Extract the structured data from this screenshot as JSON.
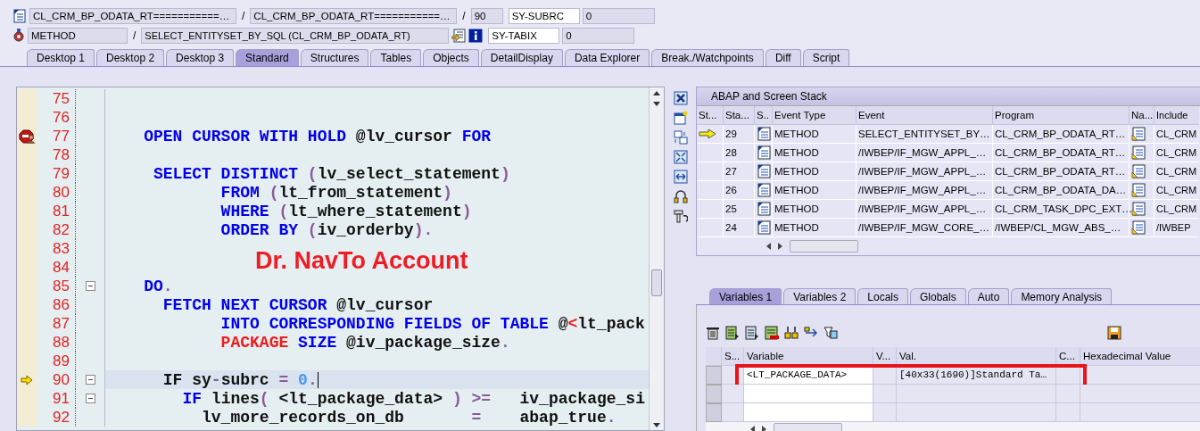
{
  "header": {
    "rows": [
      {
        "fields": [
          {
            "value": "CL_CRM_BP_ODATA_RT===========…"
          },
          {
            "sep": "/",
            "value": "CL_CRM_BP_ODATA_RT===========…"
          },
          {
            "sep": "/",
            "value": "90"
          }
        ],
        "sys": {
          "name": "SY-SUBRC",
          "value": "0"
        }
      },
      {
        "fields": [
          {
            "value": "METHOD"
          },
          {
            "sep": "/",
            "value": "SELECT_ENTITYSET_BY_SQL (CL_CRM_BP_ODATA_RT)"
          }
        ],
        "sys": {
          "name": "SY-TABIX",
          "value": "0"
        }
      }
    ]
  },
  "tabs": [
    {
      "label": "Desktop 1",
      "selected": false
    },
    {
      "label": "Desktop 2",
      "selected": false
    },
    {
      "label": "Desktop 3",
      "selected": false
    },
    {
      "label": "Standard",
      "selected": true
    },
    {
      "label": "Structures",
      "selected": false
    },
    {
      "label": "Tables",
      "selected": false
    },
    {
      "label": "Objects",
      "selected": false
    },
    {
      "label": "DetailDisplay",
      "selected": false
    },
    {
      "label": "Data Explorer",
      "selected": false
    },
    {
      "label": "Break./Watchpoints",
      "selected": false
    },
    {
      "label": "Diff",
      "selected": false
    },
    {
      "label": "Script",
      "selected": false
    }
  ],
  "editor": {
    "annotation": "Dr. NavTo Account",
    "lines": [
      {
        "number": "75",
        "fold": false,
        "highlighted": false
      },
      {
        "number": "76",
        "fold": false,
        "highlighted": false
      },
      {
        "number": "77",
        "fold": false,
        "highlighted": false,
        "breakpoint": true,
        "tokens": [
          {
            "t": "    OPEN CURSOR WITH HOLD ",
            "kind": "kw"
          },
          {
            "t": "@lv_cursor ",
            "kind": "id"
          },
          {
            "t": "FOR",
            "kind": "kw"
          }
        ]
      },
      {
        "number": "78",
        "fold": false,
        "highlighted": false
      },
      {
        "number": "79",
        "fold": false,
        "highlighted": false,
        "tokens": [
          {
            "t": "     SELECT DISTINCT ",
            "kind": "kw"
          },
          {
            "t": "(",
            "kind": "op"
          },
          {
            "t": "lv_select_statement",
            "kind": "id"
          },
          {
            "t": ")",
            "kind": "op"
          }
        ]
      },
      {
        "number": "80",
        "fold": false,
        "highlighted": false,
        "tokens": [
          {
            "t": "            FROM ",
            "kind": "kw"
          },
          {
            "t": "(",
            "kind": "op"
          },
          {
            "t": "lt_from_statement",
            "kind": "id"
          },
          {
            "t": ")",
            "kind": "op"
          }
        ]
      },
      {
        "number": "81",
        "fold": false,
        "highlighted": false,
        "tokens": [
          {
            "t": "            WHERE ",
            "kind": "kw"
          },
          {
            "t": "(",
            "kind": "op"
          },
          {
            "t": "lt_where_statement",
            "kind": "id"
          },
          {
            "t": ")",
            "kind": "op"
          }
        ]
      },
      {
        "number": "82",
        "fold": false,
        "highlighted": false,
        "tokens": [
          {
            "t": "            ORDER BY ",
            "kind": "kw"
          },
          {
            "t": "(",
            "kind": "op"
          },
          {
            "t": "iv_orderby",
            "kind": "id"
          },
          {
            "t": ").",
            "kind": "op"
          }
        ]
      },
      {
        "number": "83",
        "fold": false,
        "highlighted": false
      },
      {
        "number": "84",
        "fold": false,
        "highlighted": false
      },
      {
        "number": "85",
        "fold": true,
        "highlighted": false,
        "tokens": [
          {
            "t": "    DO",
            "kind": "kw"
          },
          {
            "t": ".",
            "kind": "op"
          }
        ]
      },
      {
        "number": "86",
        "fold": false,
        "highlighted": false,
        "tokens": [
          {
            "t": "      FETCH NEXT CURSOR ",
            "kind": "kw"
          },
          {
            "t": "@lv_cursor",
            "kind": "id"
          }
        ]
      },
      {
        "number": "87",
        "fold": false,
        "highlighted": false,
        "tokens": [
          {
            "t": "            INTO CORRESPONDING FIELDS OF TABLE ",
            "kind": "kw"
          },
          {
            "t": "@",
            "kind": "id"
          },
          {
            "t": "<",
            "kind": "lit"
          },
          {
            "t": "lt_pack",
            "kind": "id"
          }
        ]
      },
      {
        "number": "88",
        "fold": false,
        "highlighted": false,
        "tokens": [
          {
            "t": "            PACKAGE ",
            "kind": "lit"
          },
          {
            "t": "SIZE ",
            "kind": "kw"
          },
          {
            "t": "@iv_package_size",
            "kind": "id"
          },
          {
            "t": ".",
            "kind": "op"
          }
        ]
      },
      {
        "number": "89",
        "fold": false,
        "highlighted": false
      },
      {
        "number": "90",
        "fold": true,
        "highlighted": true,
        "execution_point": true,
        "tokens": [
          {
            "t": "      IF sy",
            "kind": "id"
          },
          {
            "t": "-",
            "kind": "op"
          },
          {
            "t": "subrc ",
            "kind": "id"
          },
          {
            "t": "= ",
            "kind": "op"
          },
          {
            "t": "0",
            "kind": "num"
          },
          {
            "t": ".",
            "kind": "op"
          }
        ]
      },
      {
        "number": "91",
        "fold": true,
        "highlighted": false,
        "tokens": [
          {
            "t": "        IF ",
            "kind": "kw"
          },
          {
            "t": "lines",
            "kind": "id"
          },
          {
            "t": "( ",
            "kind": "op"
          },
          {
            "t": "<lt_package_data> ",
            "kind": "id"
          },
          {
            "t": ") >=",
            "kind": "op"
          },
          {
            "t": "   iv_package_si",
            "kind": "id"
          }
        ]
      },
      {
        "number": "92",
        "fold": false,
        "highlighted": false,
        "tokens": [
          {
            "t": "          lv_more_records_on_db       ",
            "kind": "id"
          },
          {
            "t": "=",
            "kind": "op"
          },
          {
            "t": "    abap_true",
            "kind": "id"
          },
          {
            "t": ".",
            "kind": "op"
          }
        ]
      }
    ]
  },
  "stack": {
    "title": "ABAP and Screen Stack",
    "columns": [
      "St...",
      "Sta...",
      "S..",
      "Event Type",
      "Event",
      "Program",
      "Na...",
      "Include"
    ],
    "rows": [
      {
        "current": true,
        "level": "29",
        "event_type": "METHOD",
        "event": "SELECT_ENTITYSET_BY…",
        "program": "CL_CRM_BP_ODATA_RT…",
        "include": "CL_CRM"
      },
      {
        "current": false,
        "level": "28",
        "event_type": "METHOD",
        "event": "/IWBEP/IF_MGW_APPL_…",
        "program": "CL_CRM_BP_ODATA_RT…",
        "include": "CL_CRM"
      },
      {
        "current": false,
        "level": "27",
        "event_type": "METHOD",
        "event": "/IWBEP/IF_MGW_APPL_…",
        "program": "CL_CRM_BP_ODATA_RT…",
        "include": "CL_CRM"
      },
      {
        "current": false,
        "level": "26",
        "event_type": "METHOD",
        "event": "/IWBEP/IF_MGW_APPL_…",
        "program": "CL_CRM_BP_ODATA_DA…",
        "include": "CL_CRM"
      },
      {
        "current": false,
        "level": "25",
        "event_type": "METHOD",
        "event": "/IWBEP/IF_MGW_APPL_…",
        "program": "CL_CRM_TASK_DPC_EXT…",
        "include": "CL_CRM"
      },
      {
        "current": false,
        "level": "24",
        "event_type": "METHOD",
        "event": "/IWBEP/IF_MGW_CORE_…",
        "program": "/IWBEP/CL_MGW_ABS_…",
        "include": "/IWBEP"
      }
    ]
  },
  "variable_tabs": [
    {
      "label": "Variables 1",
      "selected": true
    },
    {
      "label": "Variables 2",
      "selected": false
    },
    {
      "label": "Locals",
      "selected": false
    },
    {
      "label": "Globals",
      "selected": false
    },
    {
      "label": "Auto",
      "selected": false
    },
    {
      "label": "Memory Analysis",
      "selected": false
    }
  ],
  "variables": {
    "columns": [
      "S...",
      "Variable",
      "V...",
      "Val.",
      "C...",
      "Hexadecimal Value"
    ],
    "rows": [
      {
        "variable": "<LT_PACKAGE_DATA>",
        "value": "[40x33(1690)]Standard Ta…",
        "highlighted": true
      }
    ]
  }
}
